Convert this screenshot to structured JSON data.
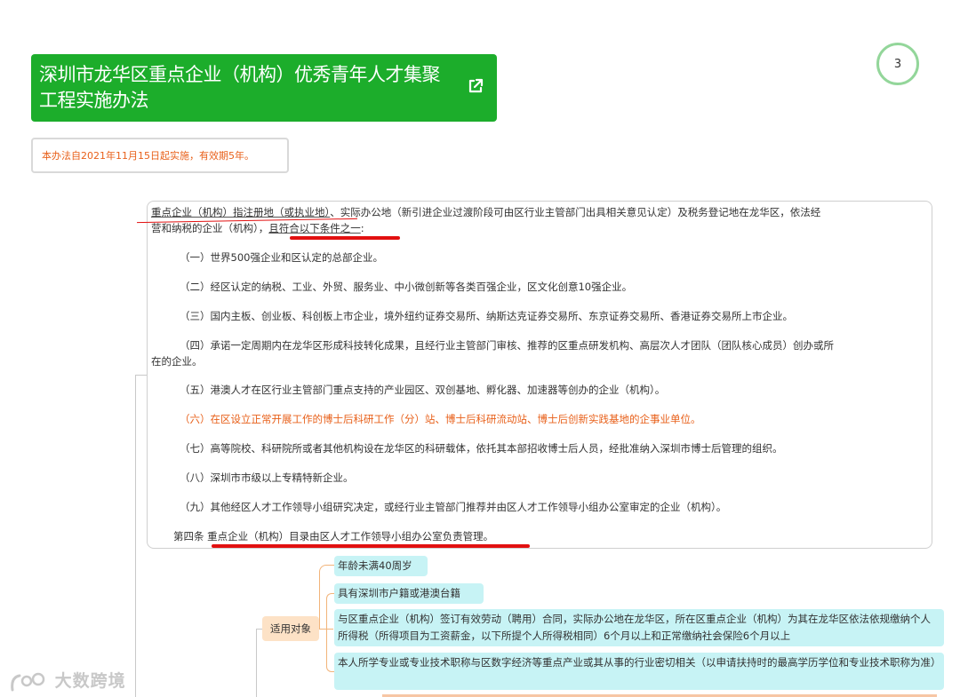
{
  "page_number": "3",
  "title": "深圳市龙华区重点企业（机构）优秀青年人才集聚工程实施办法",
  "title_bg": "#1cad2b",
  "note": "本办法自2021年11月15日起实施，有效期5年。",
  "content": {
    "intro_underlined": "重点企业（机构）指注册地（或执业地）",
    "intro_line1_rest": "、实际办公地（新引进企业过渡阶段可由区行业主管部门出具相关意见认定）及税务登记地在龙华区，依法经",
    "intro_line2_start": "营和纳税的企业（机构），",
    "intro_line2_underlined": "且符合以下条件之一",
    "intro_line2_end": ":",
    "item1": "（一）世界500强企业和区认定的总部企业。",
    "item2": "（二）经区认定的纳税、工业、外贸、服务业、中小微创新等各类百强企业，区文化创意10强企业。",
    "item3": "（三）国内主板、创业板、科创板上市企业，境外纽约证券交易所、纳斯达克证券交易所、东京证券交易所、香港证券交易所上市企业。",
    "item4_line1": "（四）承诺一定周期内在龙华区形成科技转化成果，且经行业主管部门审核、推荐的区重点研发机构、高层次人才团队（团队核心成员）创办或所",
    "item4_line2": "在的企业。",
    "item5": "（五）港澳人才在区行业主管部门重点支持的产业园区、双创基地、孵化器、加速器等创办的企业（机构）。",
    "item6": "（六）在区设立正常开展工作的博士后科研工作（分）站、博士后科研流动站、博士后创新实践基地的企事业单位。",
    "item7": "（七）高等院校、科研院所或者其他机构设在龙华区的科研载体，依托其本部招收博士后人员，经批准纳入深圳市博士后管理的组织。",
    "item8": "（八）深圳市市级以上专精特新企业。",
    "item9": "（九）其他经区人才工作领导小组研究决定，或经行业主管部门推荐并由区人才工作领导小组办公室审定的企业（机构）。",
    "article4_label": "第四条",
    "article4_text": "重点企业（机构）目录由区人才工作领导小组办公室负责管理。"
  },
  "mindmap": {
    "applies_label": "适用对象",
    "conditions": [
      "年龄未满40周岁",
      "具有深圳市户籍或港澳台籍",
      "与区重点企业（机构）签订有效劳动（聘用）合同，实际办公地在龙华区，所在区重点企业（机构）为其在龙华区依法依规缴纳个人所得税（所得项目为工资薪金，以下所提个人所得税相同）6个月以上和正常缴纳社会保险6个月以上",
      "本人所学专业或专业技术职称与区数字经济等重点产业或其从事的行业密切相关（以申请扶持时的最高学历学位和专业技术职称为准）"
    ]
  },
  "watermark": "大数跨境",
  "colors": {
    "accent_green": "#1cad2b",
    "highlight_red": "#e21010",
    "orange_text": "#e8601a",
    "node_cyan": "#c7f3f5",
    "node_peach": "#fde2c6"
  },
  "icons": {
    "external_link": "external-link-icon",
    "watermark_logo": "watermark-logo-icon"
  }
}
